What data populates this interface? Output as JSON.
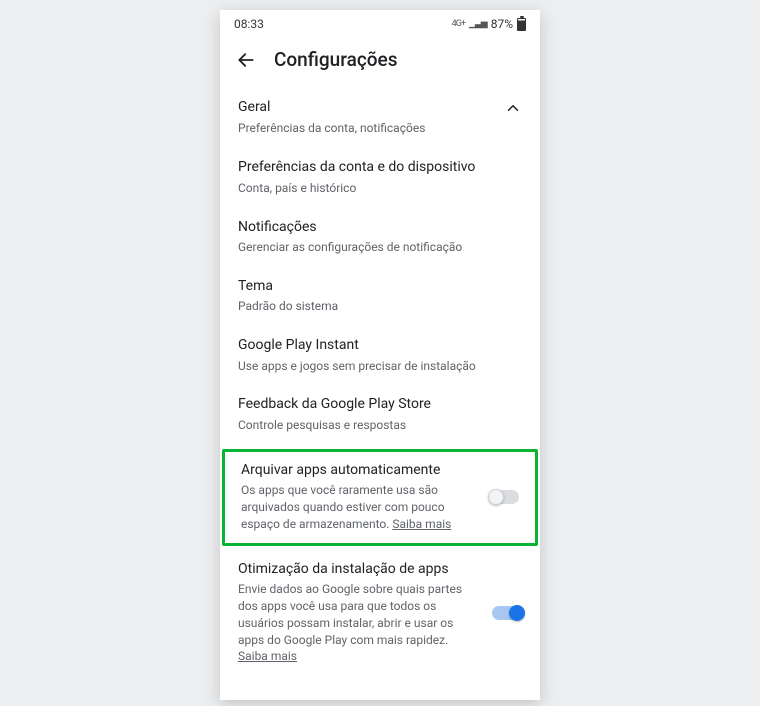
{
  "statusbar": {
    "time": "08:33",
    "net_indicator": "4G+",
    "battery_pct": "87%"
  },
  "header": {
    "title": "Configurações"
  },
  "section_general": {
    "title": "Geral",
    "subtitle": "Preferências da conta, notificações"
  },
  "items": {
    "account_prefs": {
      "title": "Preferências da conta e do dispositivo",
      "subtitle": "Conta, país e histórico"
    },
    "notifications": {
      "title": "Notificações",
      "subtitle": "Gerenciar as configurações de notificação"
    },
    "theme": {
      "title": "Tema",
      "subtitle": "Padrão do sistema"
    },
    "play_instant": {
      "title": "Google Play Instant",
      "subtitle": "Use apps e jogos sem precisar de instalação"
    },
    "feedback": {
      "title": "Feedback da Google Play Store",
      "subtitle": "Controle pesquisas e respostas"
    },
    "auto_archive": {
      "title": "Arquivar apps automaticamente",
      "subtitle": "Os apps que você raramente usa são arquivados quando estiver com pouco espaço de armazenamento. ",
      "learn_more": "Saiba mais",
      "toggle_on": false
    },
    "install_optimization": {
      "title": "Otimização da instalação de apps",
      "subtitle": "Envie dados ao Google sobre quais partes dos apps você usa para que todos os usuários possam instalar, abrir e usar os apps do Google Play com mais rapidez. ",
      "learn_more": "Saiba mais",
      "toggle_on": true
    }
  }
}
